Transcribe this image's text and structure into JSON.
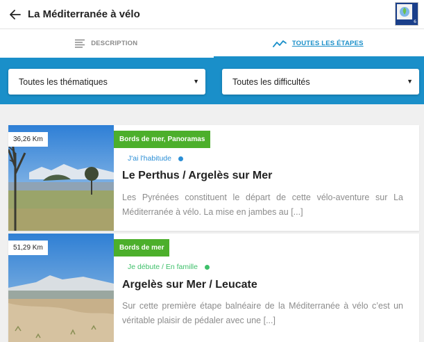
{
  "header": {
    "title": "La Méditerranée à vélo",
    "logo_number": "6"
  },
  "tabs": [
    {
      "label": "DESCRIPTION",
      "icon": "text-lines-icon",
      "active": false
    },
    {
      "label": "TOUTES LES ÉTAPES",
      "icon": "trend-line-icon",
      "active": true
    }
  ],
  "filters": {
    "thematic": {
      "value": "Toutes les thématiques"
    },
    "difficulty": {
      "value": "Toutes les difficultés"
    }
  },
  "colors": {
    "accent": "#1a8fc9",
    "tag": "#4caf2b",
    "level_blue": "#2c8fd6",
    "level_green": "#3ec06a"
  },
  "stages": [
    {
      "distance": "36,26 Km",
      "tag": "Bords de mer, Panoramas",
      "level": "J'ai l'habitude",
      "title": "Le Perthus / Argelès sur Mer",
      "description": "Les Pyrénées constituent le départ de cette vélo-aventure sur La Méditerranée à vélo. La mise en jambes au [...]"
    },
    {
      "distance": "51,29 Km",
      "tag": "Bords de mer",
      "level": "Je débute / En famille",
      "title": "Argelès sur Mer / Leucate",
      "description": "Sur cette première étape balnéaire de la Méditerranée à vélo c’est un véritable plaisir de pédaler avec une [...]"
    }
  ]
}
